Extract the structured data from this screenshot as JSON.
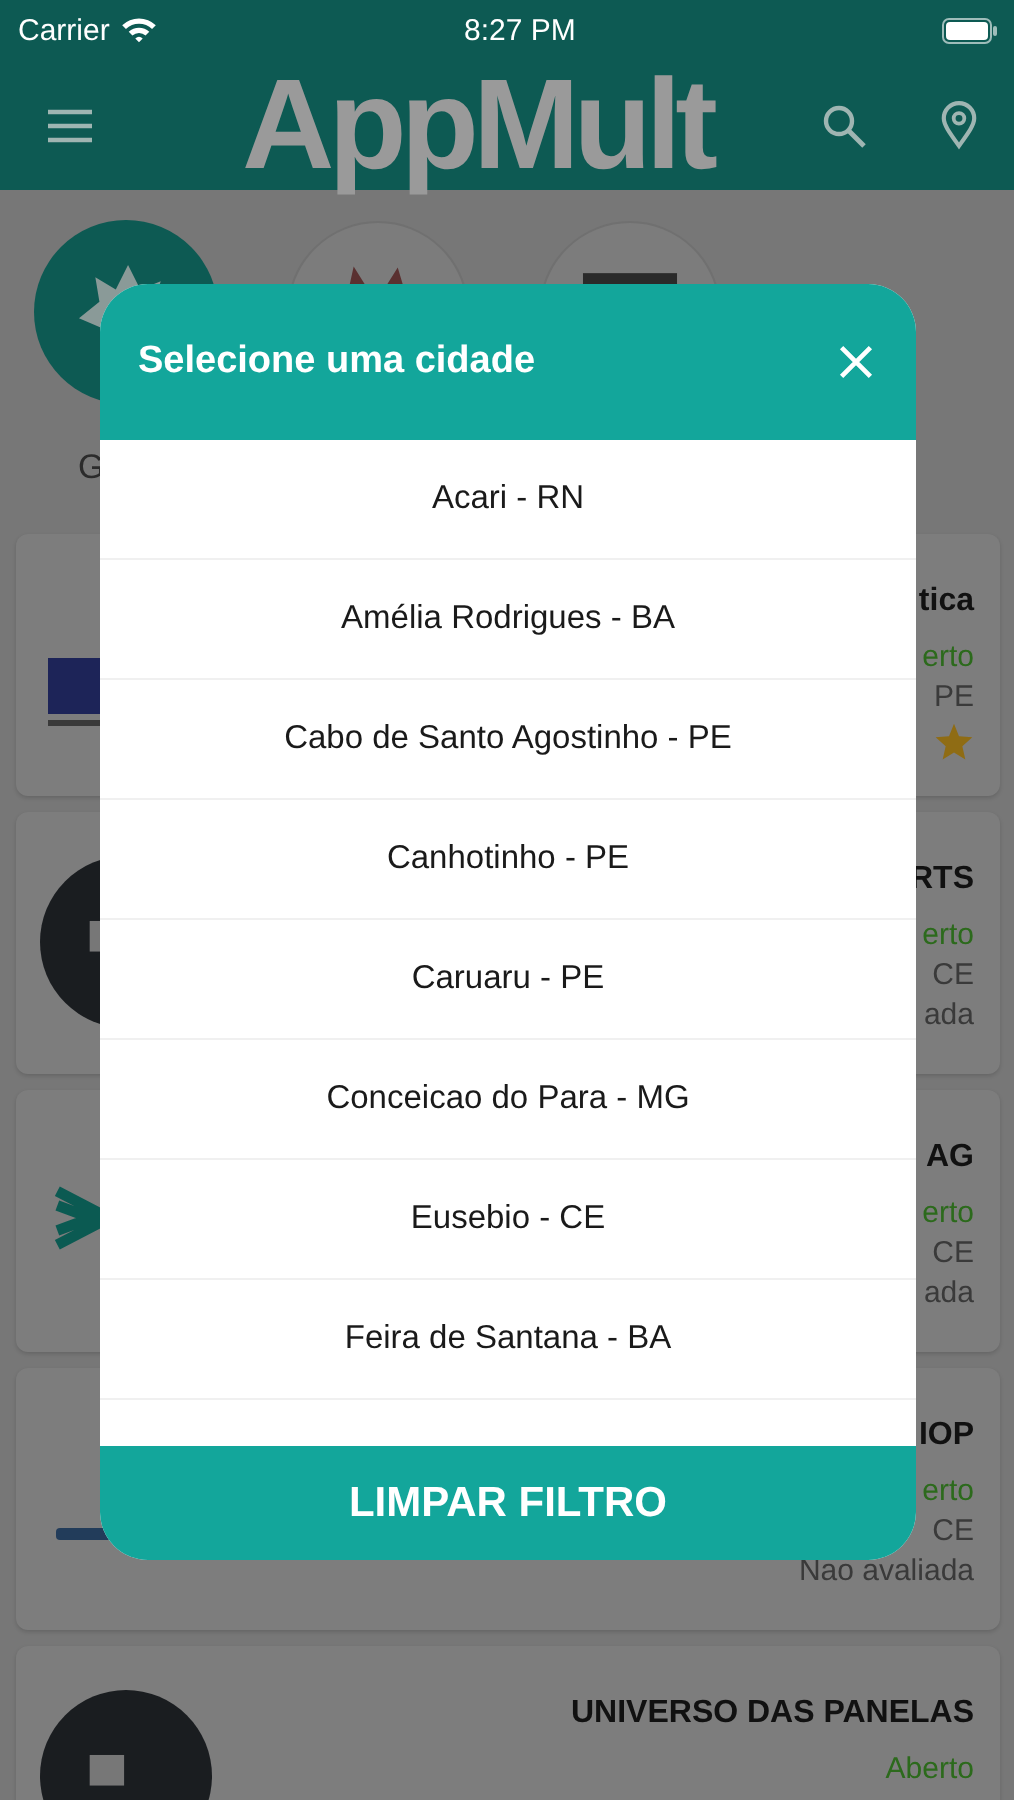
{
  "status_bar": {
    "carrier": "Carrier",
    "time": "8:27 PM"
  },
  "header": {
    "logo": "AppMult"
  },
  "categories": [
    {
      "kind": "star",
      "label": "G"
    },
    {
      "kind": "mask"
    },
    {
      "kind": "screen"
    }
  ],
  "cards": [
    {
      "logo": {
        "kind": "letter"
      },
      "title": "tica",
      "status": "erto",
      "city": "PE",
      "rating": {
        "kind": "star"
      }
    },
    {
      "logo": {
        "kind": "dark"
      },
      "title": "RTS",
      "status": "erto",
      "city": "CE",
      "rating": {
        "kind": "text",
        "text": "ada"
      }
    },
    {
      "logo": {
        "kind": "wave"
      },
      "title": "AG",
      "status": "erto",
      "city": "CE",
      "rating": {
        "kind": "text",
        "text": "ada"
      }
    },
    {
      "logo": {
        "kind": "plain"
      },
      "title": "IOP",
      "status": "erto",
      "city": "CE",
      "rating": {
        "kind": "text",
        "text": "Nao avaliada"
      }
    },
    {
      "logo": {
        "kind": "dark"
      },
      "title": "UNIVERSO DAS PANELAS",
      "status": "Aberto"
    }
  ],
  "modal": {
    "title": "Selecione uma cidade",
    "cities": [
      "Acari - RN",
      "Amélia Rodrigues - BA",
      "Cabo de Santo Agostinho - PE",
      "Canhotinho - PE",
      "Caruaru - PE",
      "Conceicao do Para - MG",
      "Eusebio - CE",
      "Feira de Santana - BA"
    ],
    "clear_button": "LIMPAR FILTRO"
  }
}
